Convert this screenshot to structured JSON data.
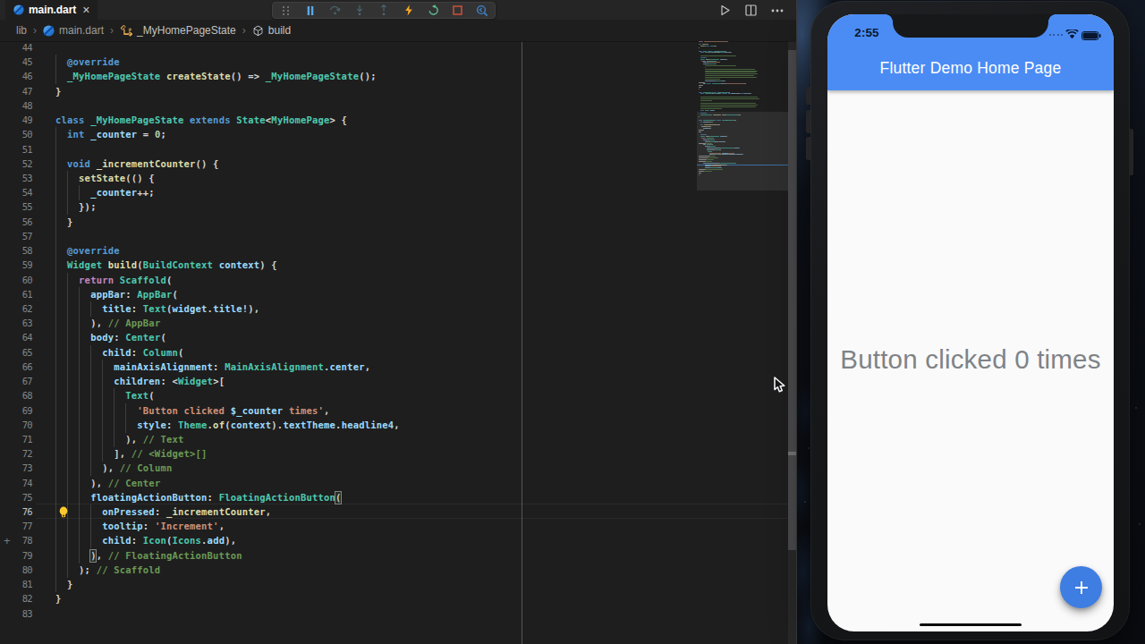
{
  "window": {
    "tab": {
      "title": "main.dart",
      "close_label": "×"
    },
    "editor_actions": {
      "run": "run",
      "split": "split-editor",
      "more": "more-actions"
    }
  },
  "debug_toolbar": {
    "items": [
      {
        "name": "drag-handle"
      },
      {
        "name": "pause"
      },
      {
        "name": "step-over"
      },
      {
        "name": "step-into"
      },
      {
        "name": "step-out"
      },
      {
        "name": "hot-reload"
      },
      {
        "name": "restart"
      },
      {
        "name": "stop"
      },
      {
        "name": "widget-inspector"
      }
    ]
  },
  "breadcrumbs": [
    {
      "label": "lib",
      "icon": "none"
    },
    {
      "label": "main.dart",
      "icon": "dart-file"
    },
    {
      "label": "_MyHomePageState",
      "icon": "symbol-class"
    },
    {
      "label": "build",
      "icon": "symbol-method"
    }
  ],
  "editor": {
    "first_line_number": 44,
    "active_line": 76,
    "lightbulb_line": 76,
    "gutter_plus_line": 78,
    "gutter_plus_label": "+",
    "ruler_column": 81,
    "bracket_matches": [
      {
        "line": 75,
        "col": 48
      },
      {
        "line": 79,
        "col": 6
      }
    ],
    "lines": [
      "",
      "  @override",
      "  _MyHomePageState createState() => _MyHomePageState();",
      "}",
      "",
      "class _MyHomePageState extends State<MyHomePage> {",
      "  int _counter = 0;",
      "",
      "  void _incrementCounter() {",
      "    setState(() {",
      "      _counter++;",
      "    });",
      "  }",
      "",
      "  @override",
      "  Widget build(BuildContext context) {",
      "    return Scaffold(",
      "      appBar: AppBar(",
      "        title: Text(widget.title!),",
      "      ), // AppBar",
      "      body: Center(",
      "        child: Column(",
      "          mainAxisAlignment: MainAxisAlignment.center,",
      "          children: <Widget>[",
      "            Text(",
      "              'Button clicked $_counter times',",
      "              style: Theme.of(context).textTheme.headline4,",
      "            ), // Text",
      "          ], // <Widget>[]",
      "        ), // Column",
      "      ), // Center",
      "      floatingActionButton: FloatingActionButton(",
      "        onPressed: _incrementCounter,",
      "        tooltip: 'Increment',",
      "        child: Icon(Icons.add),",
      "      ), // FloatingActionButton",
      "    ); // Scaffold",
      "  }",
      "}",
      ""
    ],
    "colors": {
      "keyword": "#569CD6",
      "control": "#C586C0",
      "type": "#4EC9B0",
      "function": "#DCDCAA",
      "variable": "#9CDCFE",
      "string": "#CE9178",
      "number": "#B5CEA8",
      "comment": "#6A9955",
      "punctuation": "#D4D4D4"
    }
  },
  "minimap": {
    "pre_lines": [
      "import 'package:flutter/material.dart';",
      "",
      "void main() {",
      "  runApp(const MyApp());",
      "}",
      "",
      "class MyApp extends StatelessWidget {",
      "  const MyApp({Key? key}) : super(key: key);",
      "",
      "  // This widget is the root of your application.",
      "  @override",
      "  Widget build(BuildContext context) {",
      "    return MaterialApp(",
      "      title: 'Flutter Demo',",
      "      theme: ThemeData(",
      "        // This is the theme of your application.",
      "        //",
      "        // Try running your application with \"flutter run\". You'll see the",
      "        // application has a blue toolbar. Then, without quitting the app, try",
      "        // changing the primarySwatch below to Colors.green and then invoke",
      "        // \"hot reload\" (press \"r\" in the console where you ran \"flutter run\",",
      "        // or simply save your changes to \"hot reload\" in a Flutter IDE).",
      "        // Notice that the counter didn't reset back to zero; the application",
      "        // is not restarted.",
      "        primarySwatch: Colors.blue,",
      "      ),",
      "      home: const MyHomePage(title: 'Flutter Demo Home Page'),",
      "    );",
      "  }",
      "}",
      "",
      "class MyHomePage extends StatefulWidget {",
      "  const MyHomePage({Key? key, required this.title}) : super(key: key);",
      "",
      "  // This widget is the home page of your application. It is stateful, meaning",
      "  // that it has a State object (defined below) that contains fields that affect",
      "  // how it looks.",
      "",
      "  // This class is the configuration for the state. It holds the values (in",
      "  // this case the title) provided by the parent (in this case the App widget)",
      "  // and used by the build method of the State. Fields in a Widget subclass",
      "  // are always marked \"final\".",
      "  final String title;"
    ]
  },
  "phone": {
    "status": {
      "time": "2:55"
    },
    "appbar_title": "Flutter Demo Home Page",
    "body_text": "Button clicked 0 times",
    "fab_icon": "plus",
    "colors": {
      "appbar": "#4b8cf4",
      "fab": "#3e7de2",
      "body": "#fafafa"
    }
  }
}
